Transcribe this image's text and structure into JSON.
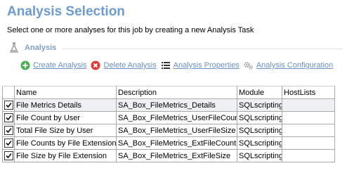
{
  "header": {
    "title": "Analysis Selection",
    "subtitle": "Select one or more analyses for this job by creating a new Analysis Task"
  },
  "section": {
    "label": "Analysis",
    "icon": "flask-icon"
  },
  "toolbar": {
    "create_label": "Create Analysis",
    "delete_label": "Delete Analysis",
    "properties_label": "Analysis Properties",
    "configuration_label": "Analysis Configuration"
  },
  "colors": {
    "title": "#6d9bd1",
    "link": "#6b8fc7",
    "create_icon": "#4caf50",
    "delete_icon": "#e53935"
  },
  "table": {
    "columns": [
      "Name",
      "Description",
      "Module",
      "HostLists"
    ],
    "rows": [
      {
        "checked": true,
        "name": "File Metrics Details",
        "description": "SA_Box_FileMetrics_Details",
        "module": "SQLscripting",
        "hostlists": ""
      },
      {
        "checked": true,
        "name": "File Count by User",
        "description": "SA_Box_FileMetrics_UserFileCount",
        "module": "SQLscripting",
        "hostlists": ""
      },
      {
        "checked": true,
        "name": "Total File Size by User",
        "description": "SA_Box_FileMetrics_UserFileSize",
        "module": "SQLscripting",
        "hostlists": ""
      },
      {
        "checked": true,
        "name": "File Counts by File Extension",
        "description": "SA_Box_FileMetrics_ExtFileCount",
        "module": "SQLscripting",
        "hostlists": ""
      },
      {
        "checked": true,
        "name": "File Size by File Extension",
        "description": "SA_Box_FileMetrics_ExtFileSize",
        "module": "SQLscripting",
        "hostlists": ""
      }
    ]
  }
}
